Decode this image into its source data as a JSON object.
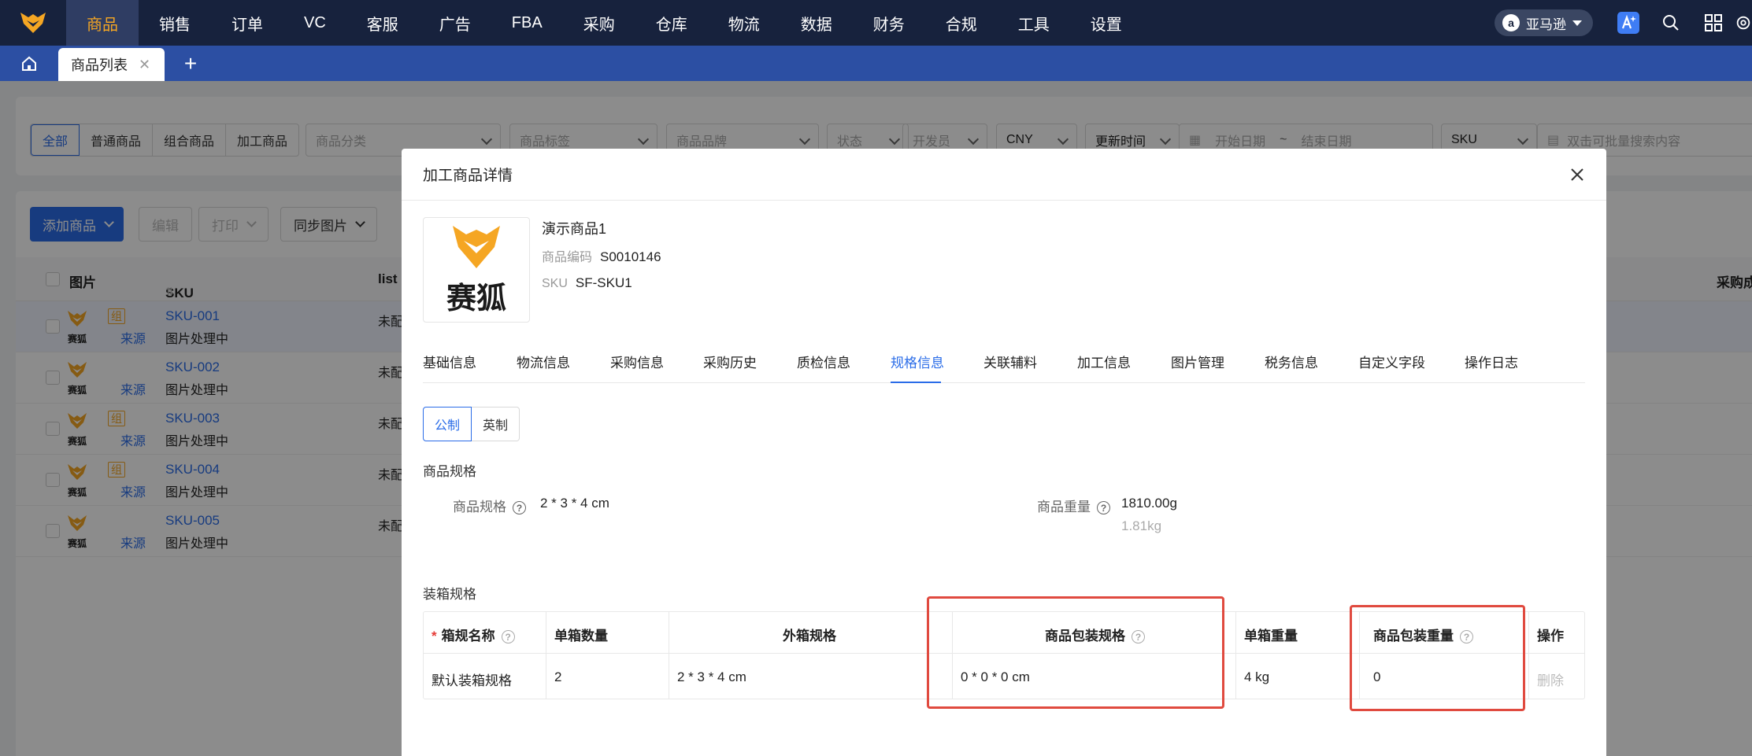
{
  "nav": {
    "items": [
      "商品",
      "销售",
      "订单",
      "VC",
      "客服",
      "广告",
      "FBA",
      "采购",
      "仓库",
      "物流",
      "数据",
      "财务",
      "合规",
      "工具",
      "设置"
    ],
    "active_index": 0,
    "marketplace": "亚马逊"
  },
  "tabbar": {
    "tab_label": "商品列表"
  },
  "filters": {
    "types": [
      "全部",
      "普通商品",
      "组合商品",
      "加工商品"
    ],
    "category_placeholder": "商品分类",
    "tag_placeholder": "商品标签",
    "brand_placeholder": "商品品牌",
    "status_placeholder": "状态",
    "developer_placeholder": "开发员",
    "currency": "CNY",
    "time_field": "更新时间",
    "start_date": "开始日期",
    "date_sep": "~",
    "end_date": "结束日期",
    "search_field": "SKU",
    "search_placeholder": "双击可批量搜索内容"
  },
  "toolbar": {
    "add": "添加商品",
    "edit": "编辑",
    "print": "打印",
    "sync_images": "同步图片"
  },
  "list": {
    "headers": {
      "image": "图片",
      "sku": "SKU",
      "listing": "list",
      "purchase": "采购成"
    },
    "rows": [
      {
        "sku": "SKU-001",
        "status": "图片处理中",
        "tag": "组",
        "source": "来源",
        "listing": "未配"
      },
      {
        "sku": "SKU-002",
        "status": "图片处理中",
        "tag": "",
        "source": "来源",
        "listing": "未配"
      },
      {
        "sku": "SKU-003",
        "status": "图片处理中",
        "tag": "组",
        "source": "来源",
        "listing": "未配"
      },
      {
        "sku": "SKU-004",
        "status": "图片处理中",
        "tag": "组",
        "source": "来源",
        "listing": "未配"
      },
      {
        "sku": "SKU-005",
        "status": "图片处理中",
        "tag": "",
        "source": "来源",
        "listing": "未配"
      }
    ],
    "thumb_text": "赛狐"
  },
  "modal": {
    "title": "加工商品详情",
    "product": {
      "brand_text": "赛狐",
      "name": "演示商品1",
      "code_label": "商品编码",
      "code": "S0010146",
      "sku_label": "SKU",
      "sku": "SF-SKU1"
    },
    "tabs": [
      "基础信息",
      "物流信息",
      "采购信息",
      "采购历史",
      "质检信息",
      "规格信息",
      "关联辅料",
      "加工信息",
      "图片管理",
      "税务信息",
      "自定义字段",
      "操作日志"
    ],
    "active_tab": 5,
    "units": {
      "metric": "公制",
      "imperial": "英制"
    },
    "spec_section": "商品规格",
    "spec_label": "商品规格",
    "spec_value": "2 * 3 * 4 cm",
    "weight_label": "商品重量",
    "weight_value": "1810.00g",
    "weight_kg": "1.81kg",
    "box_section": "装箱规格",
    "box_table": {
      "headers": [
        "箱规名称",
        "单箱数量",
        "外箱规格",
        "商品包装规格",
        "单箱重量",
        "商品包装重量",
        "操作"
      ],
      "row": [
        "默认装箱规格",
        "2",
        "2 * 3 * 4 cm",
        "0 * 0 * 0 cm",
        "4 kg",
        "0",
        "删除"
      ]
    }
  },
  "colors": {
    "nav_bg": "#17223d",
    "tabbar_bg": "#2c4fa3",
    "accent": "#2a6ce8",
    "active_nav_text": "#f5a623",
    "highlight_box": "#e04a3f"
  }
}
